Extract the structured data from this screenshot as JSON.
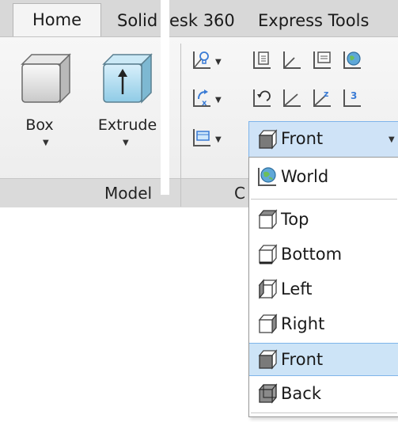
{
  "ribbon": {
    "tabs": [
      {
        "label": "Home"
      },
      {
        "label": "Solid"
      },
      {
        "label": "esk 360"
      },
      {
        "label": "Express Tools"
      }
    ],
    "active_tab": "Home",
    "buttons": {
      "box_label": "Box",
      "extrude_label": "Extrude"
    },
    "panels": {
      "modeling_label": "Model",
      "coordinates_label": "C"
    },
    "ucs_icons": [
      "ucs-icon",
      "ucs-named-icon",
      "ucs-origin-icon",
      "ucs-view-icon",
      "ucs-world-icon",
      "ucs-object-icon",
      "ucs-previous-icon",
      "ucs-3point-icon",
      "ucs-z-axis-icon",
      "ucs-3-icon",
      "ucs-face-icon"
    ]
  },
  "view_dropdown": {
    "selected": "Front",
    "items": [
      {
        "label": "World",
        "icon": "globe-icon"
      },
      {
        "label": "Top",
        "icon": "cube-top-icon"
      },
      {
        "label": "Bottom",
        "icon": "cube-bottom-icon"
      },
      {
        "label": "Left",
        "icon": "cube-left-icon"
      },
      {
        "label": "Right",
        "icon": "cube-right-icon"
      },
      {
        "label": "Front",
        "icon": "cube-front-icon",
        "highlighted": true
      },
      {
        "label": "Back",
        "icon": "cube-back-icon"
      }
    ]
  },
  "colors": {
    "selection": "#cde4f7",
    "selection_border": "#7eb4ea",
    "ribbon_bg": "#efefef",
    "tab_strip": "#d8d8d8"
  }
}
